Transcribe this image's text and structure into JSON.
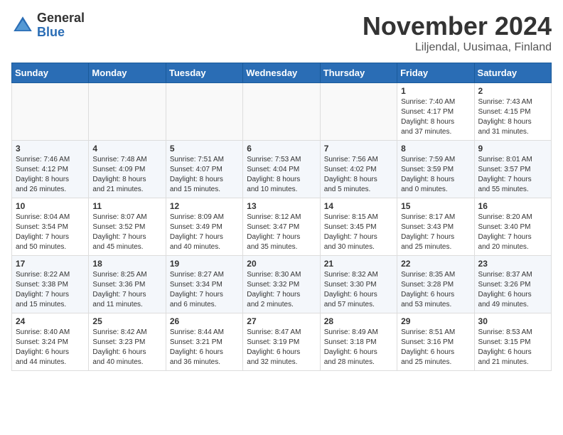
{
  "logo": {
    "general": "General",
    "blue": "Blue"
  },
  "title": {
    "month": "November 2024",
    "location": "Liljendal, Uusimaa, Finland"
  },
  "weekdays": [
    "Sunday",
    "Monday",
    "Tuesday",
    "Wednesday",
    "Thursday",
    "Friday",
    "Saturday"
  ],
  "weeks": [
    [
      {
        "day": "",
        "info": ""
      },
      {
        "day": "",
        "info": ""
      },
      {
        "day": "",
        "info": ""
      },
      {
        "day": "",
        "info": ""
      },
      {
        "day": "",
        "info": ""
      },
      {
        "day": "1",
        "info": "Sunrise: 7:40 AM\nSunset: 4:17 PM\nDaylight: 8 hours\nand 37 minutes."
      },
      {
        "day": "2",
        "info": "Sunrise: 7:43 AM\nSunset: 4:15 PM\nDaylight: 8 hours\nand 31 minutes."
      }
    ],
    [
      {
        "day": "3",
        "info": "Sunrise: 7:46 AM\nSunset: 4:12 PM\nDaylight: 8 hours\nand 26 minutes."
      },
      {
        "day": "4",
        "info": "Sunrise: 7:48 AM\nSunset: 4:09 PM\nDaylight: 8 hours\nand 21 minutes."
      },
      {
        "day": "5",
        "info": "Sunrise: 7:51 AM\nSunset: 4:07 PM\nDaylight: 8 hours\nand 15 minutes."
      },
      {
        "day": "6",
        "info": "Sunrise: 7:53 AM\nSunset: 4:04 PM\nDaylight: 8 hours\nand 10 minutes."
      },
      {
        "day": "7",
        "info": "Sunrise: 7:56 AM\nSunset: 4:02 PM\nDaylight: 8 hours\nand 5 minutes."
      },
      {
        "day": "8",
        "info": "Sunrise: 7:59 AM\nSunset: 3:59 PM\nDaylight: 8 hours\nand 0 minutes."
      },
      {
        "day": "9",
        "info": "Sunrise: 8:01 AM\nSunset: 3:57 PM\nDaylight: 7 hours\nand 55 minutes."
      }
    ],
    [
      {
        "day": "10",
        "info": "Sunrise: 8:04 AM\nSunset: 3:54 PM\nDaylight: 7 hours\nand 50 minutes."
      },
      {
        "day": "11",
        "info": "Sunrise: 8:07 AM\nSunset: 3:52 PM\nDaylight: 7 hours\nand 45 minutes."
      },
      {
        "day": "12",
        "info": "Sunrise: 8:09 AM\nSunset: 3:49 PM\nDaylight: 7 hours\nand 40 minutes."
      },
      {
        "day": "13",
        "info": "Sunrise: 8:12 AM\nSunset: 3:47 PM\nDaylight: 7 hours\nand 35 minutes."
      },
      {
        "day": "14",
        "info": "Sunrise: 8:15 AM\nSunset: 3:45 PM\nDaylight: 7 hours\nand 30 minutes."
      },
      {
        "day": "15",
        "info": "Sunrise: 8:17 AM\nSunset: 3:43 PM\nDaylight: 7 hours\nand 25 minutes."
      },
      {
        "day": "16",
        "info": "Sunrise: 8:20 AM\nSunset: 3:40 PM\nDaylight: 7 hours\nand 20 minutes."
      }
    ],
    [
      {
        "day": "17",
        "info": "Sunrise: 8:22 AM\nSunset: 3:38 PM\nDaylight: 7 hours\nand 15 minutes."
      },
      {
        "day": "18",
        "info": "Sunrise: 8:25 AM\nSunset: 3:36 PM\nDaylight: 7 hours\nand 11 minutes."
      },
      {
        "day": "19",
        "info": "Sunrise: 8:27 AM\nSunset: 3:34 PM\nDaylight: 7 hours\nand 6 minutes."
      },
      {
        "day": "20",
        "info": "Sunrise: 8:30 AM\nSunset: 3:32 PM\nDaylight: 7 hours\nand 2 minutes."
      },
      {
        "day": "21",
        "info": "Sunrise: 8:32 AM\nSunset: 3:30 PM\nDaylight: 6 hours\nand 57 minutes."
      },
      {
        "day": "22",
        "info": "Sunrise: 8:35 AM\nSunset: 3:28 PM\nDaylight: 6 hours\nand 53 minutes."
      },
      {
        "day": "23",
        "info": "Sunrise: 8:37 AM\nSunset: 3:26 PM\nDaylight: 6 hours\nand 49 minutes."
      }
    ],
    [
      {
        "day": "24",
        "info": "Sunrise: 8:40 AM\nSunset: 3:24 PM\nDaylight: 6 hours\nand 44 minutes."
      },
      {
        "day": "25",
        "info": "Sunrise: 8:42 AM\nSunset: 3:23 PM\nDaylight: 6 hours\nand 40 minutes."
      },
      {
        "day": "26",
        "info": "Sunrise: 8:44 AM\nSunset: 3:21 PM\nDaylight: 6 hours\nand 36 minutes."
      },
      {
        "day": "27",
        "info": "Sunrise: 8:47 AM\nSunset: 3:19 PM\nDaylight: 6 hours\nand 32 minutes."
      },
      {
        "day": "28",
        "info": "Sunrise: 8:49 AM\nSunset: 3:18 PM\nDaylight: 6 hours\nand 28 minutes."
      },
      {
        "day": "29",
        "info": "Sunrise: 8:51 AM\nSunset: 3:16 PM\nDaylight: 6 hours\nand 25 minutes."
      },
      {
        "day": "30",
        "info": "Sunrise: 8:53 AM\nSunset: 3:15 PM\nDaylight: 6 hours\nand 21 minutes."
      }
    ]
  ]
}
